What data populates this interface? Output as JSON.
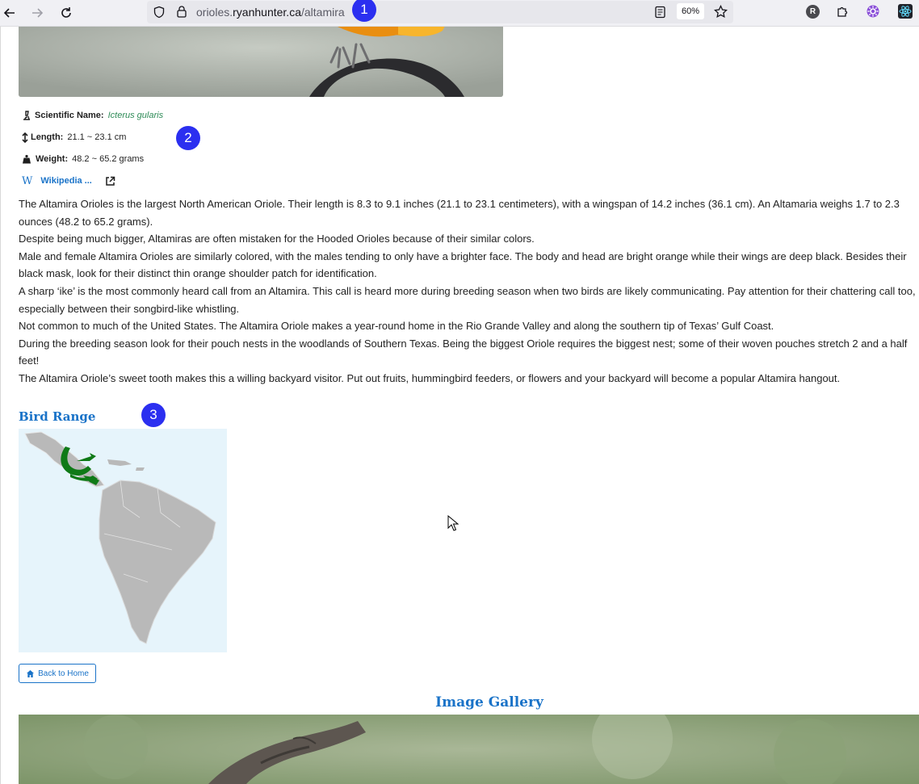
{
  "browser": {
    "url_prefix": "orioles.",
    "url_domain": "ryanhunter.ca",
    "url_path": "/altamira",
    "zoom": "60%",
    "profile_initial": "R"
  },
  "annotations": {
    "step1": "1",
    "step2": "2",
    "step3": "3"
  },
  "facts": {
    "scientific_label": "Scientific Name:",
    "scientific_value": "Icterus gularis",
    "length_label": "Length:",
    "length_value": "21.1 ~ 23.1 cm",
    "weight_label": "Weight:",
    "weight_value": "48.2 ~ 65.2 grams",
    "wiki_label": "Wikipedia ..."
  },
  "description": [
    "The Altamira Orioles is the largest North American Oriole. Their length is 8.3 to 9.1 inches (21.1 to 23.1 centimeters), with a wingspan of 14.2 inches (36.1 cm). An Altamaria weighs 1.7 to 2.3 ounces (48.2 to 65.2 grams).",
    "Despite being much bigger, Altamiras are often mistaken for the Hooded Orioles because of their similar colors.",
    "Male and female Altamira Orioles are similarly colored, with the males tending to only have a brighter face. The body and head are bright orange while their wings are deep black. Besides their black mask, look for their distinct thin orange shoulder patch for identification.",
    "A sharp ‘ike’ is the most commonly heard call from an Altamira. This call is heard more during breeding season when two birds are likely communicating. Pay attention for their chattering call too, especially between their songbird-like whistling.",
    "Not common to much of the United States. The Altamira Oriole makes a year-round home in the Rio Grande Valley and along the southern tip of Texas’ Gulf Coast.",
    "During the breeding season look for their pouch nests in the woodlands of Southern Texas. Being the biggest Oriole requires the biggest nest; some of their woven pouches stretch 2 and a half feet!",
    "The Altamira Oriole’s sweet tooth makes this a willing backyard visitor. Put out fruits, hummingbird feeders, or flowers and your backyard will become a popular Altamira hangout."
  ],
  "range": {
    "heading": "Bird Range"
  },
  "home_button": {
    "label": "Back to Home"
  },
  "gallery": {
    "heading": "Image Gallery"
  },
  "colors": {
    "accent": "#1a73c8",
    "scientific": "#2e8b57",
    "annotation": "#2b2ff0",
    "range_fill": "#0f7a17"
  }
}
